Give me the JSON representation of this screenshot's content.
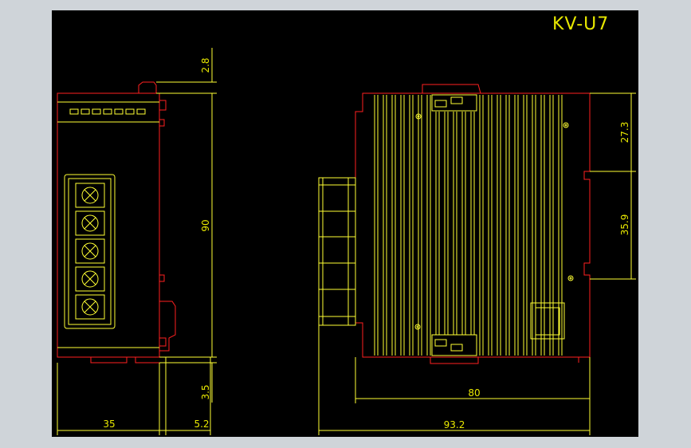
{
  "drawing": {
    "title": "KV-U7",
    "colors": {
      "background": "#000000",
      "outline": "#ff2020",
      "detail": "#ffff33",
      "frame": "#cfd4d9"
    }
  },
  "dimensions": {
    "top_gap": "2.8",
    "height": "90",
    "bottom_gap": "3.5",
    "width_front": "35",
    "width_tab": "5.2",
    "upper_span": "27.3",
    "lower_span": "35.9",
    "depth_body": "80",
    "depth_total": "93.2"
  },
  "terminal_block": {
    "screw_count": 5
  }
}
